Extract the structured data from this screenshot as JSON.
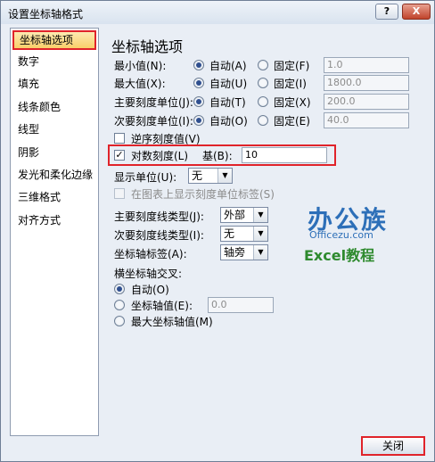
{
  "window": {
    "title": "设置坐标轴格式",
    "help_label": "?",
    "close_label": "X"
  },
  "categories": [
    {
      "label": "坐标轴选项",
      "selected": true
    },
    {
      "label": "数字"
    },
    {
      "label": "填充"
    },
    {
      "label": "线条颜色"
    },
    {
      "label": "线型"
    },
    {
      "label": "阴影"
    },
    {
      "label": "发光和柔化边缘"
    },
    {
      "label": "三维格式"
    },
    {
      "label": "对齐方式"
    }
  ],
  "panel": {
    "heading": "坐标轴选项",
    "scale_rows": [
      {
        "label": "最小值(N):",
        "auto": "自动(A)",
        "fixed": "固定(F)",
        "value": "1.0"
      },
      {
        "label": "最大值(X):",
        "auto": "自动(U)",
        "fixed": "固定(I)",
        "value": "1800.0"
      },
      {
        "label": "主要刻度单位(J):",
        "auto": "自动(T)",
        "fixed": "固定(X)",
        "value": "200.0"
      },
      {
        "label": "次要刻度单位(I):",
        "auto": "自动(O)",
        "fixed": "固定(E)",
        "value": "40.0"
      }
    ],
    "reverse_order": "逆序刻度值(V)",
    "log_scale": {
      "label": "对数刻度(L)",
      "base_label": "基(B):",
      "base_value": "10"
    },
    "display_units": {
      "label": "显示单位(U):",
      "value": "无"
    },
    "show_units_label": "在图表上显示刻度单位标签(S)",
    "major_tick": {
      "label": "主要刻度线类型(J):",
      "value": "外部"
    },
    "minor_tick": {
      "label": "次要刻度线类型(I):",
      "value": "无"
    },
    "axis_labels": {
      "label": "坐标轴标签(A):",
      "value": "轴旁"
    },
    "crosses": {
      "heading": "横坐标轴交叉:",
      "auto": "自动(O)",
      "axis_value": "坐标轴值(E):",
      "axis_value_input": "0.0",
      "max_value": "最大坐标轴值(M)"
    }
  },
  "watermark": {
    "line1": "办公族",
    "line2": "Officezu.com",
    "line3": "Excel教程"
  },
  "footer": {
    "close_label": "关闭"
  },
  "colors": {
    "highlight": "#e0232a",
    "selected_bg": "#f9cf6a",
    "dialog_bg": "#e9eef5"
  }
}
